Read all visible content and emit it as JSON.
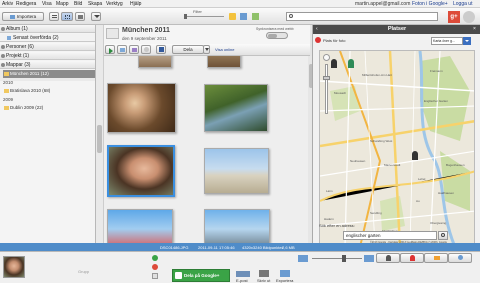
{
  "menubar": {
    "items": [
      "Arkiv",
      "Redigera",
      "Visa",
      "Mapp",
      "Bild",
      "Skapa",
      "Verktyg",
      "Hjälp"
    ],
    "user": "martin.appel@gmail.com",
    "photos_link": "Foton i Google+",
    "logout": "Logga ut"
  },
  "toolbar": {
    "import_label": "Importera",
    "filter_label": "Filter"
  },
  "sidebar": {
    "folders": [
      {
        "label": "Album (1)"
      },
      {
        "label": "Senast överförda (2)"
      },
      {
        "label": "Personer (6)"
      },
      {
        "label": "Projekt (1)"
      },
      {
        "label": "Mappar (3)"
      }
    ],
    "selected_item": "München 2011 (12)",
    "groups": [
      {
        "year": "2010",
        "item": "Bratislava 2010 (68)"
      },
      {
        "year": "2009",
        "item": "Dublin 2009 (22)"
      }
    ]
  },
  "album": {
    "title": "München 2011",
    "subtitle": "den 9 september 2011",
    "sync_label": "Synkronisera med webb",
    "share_label": "Dela",
    "show_online": "Visa online"
  },
  "places": {
    "title": "Platser",
    "pin_label": "Plats för foto",
    "map_type": "Karta över g...",
    "search_label": "Sök efter en adress:",
    "search_value": "englischer garten",
    "map_credit": "©2013 Google - Kartdata ©2013 GeoBasis-DE/BKG (©2009), Google",
    "map_labels": [
      "Moosach",
      "Milbertshofen-Am Hart",
      "Freimann",
      "Schwabing West",
      "Englischer Garten",
      "Bogenhausen",
      "Neuhausen",
      "Maxvorstadt",
      "Lehel",
      "Laim",
      "Au",
      "Haidhausen",
      "Hadern",
      "Obergiesing",
      "Sendling",
      "Thalkirchen"
    ]
  },
  "status": {
    "file": "DSC01486.JPG",
    "date": "2011-09-11 17:05:46",
    "size": "4320x3240 Bildpunkter",
    "file_size": "2,6 MB"
  },
  "bottom": {
    "share_google": "Dela på Google+",
    "email": "E-post",
    "print": "Skriv ut",
    "export": "Exportera",
    "hold_label": "Grupp"
  },
  "colors": {
    "status_bar": "#4f8cc9",
    "share_button": "#3aa346",
    "selected_border": "#3b8fe0"
  }
}
